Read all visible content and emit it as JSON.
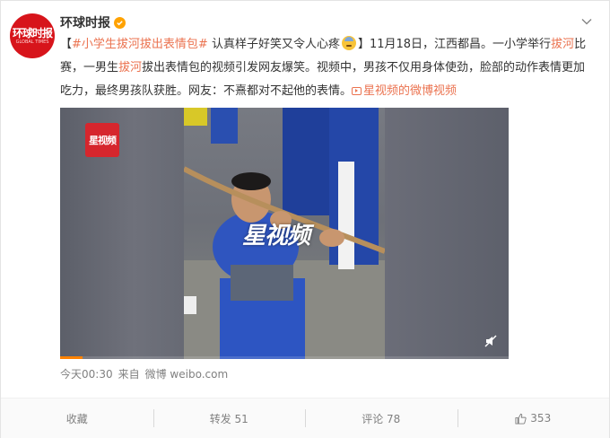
{
  "post": {
    "author": "环球时报",
    "avatar_text": "环球时报",
    "avatar_subtext": "GLOBAL TIMES",
    "text_parts": {
      "bracket_open": "【",
      "topic": "#小学生拔河拔出表情包#",
      "after_topic": " 认真样子好笑又令人心疼",
      "bracket_close": "】11月18日，江西都昌。一小学举行",
      "hl1": "拔河",
      "p1": "比赛，一男生",
      "hl2": "拔河",
      "p2": "拔出表情包的视频引发网友爆笑。视频中，男孩不仅用身体使劲，脸部的动作表情更加吃力，最终男孩队获胜。网友：不熹都对不起他的表情。",
      "video_link": "星视频的微博视频"
    },
    "video": {
      "corner_logo": "星视频",
      "watermark": "星视频",
      "progress": 0.05
    },
    "meta": {
      "time": "今天00:30",
      "source_prefix": "来自",
      "source": "微博 weibo.com"
    },
    "actions": {
      "favorite": "收藏",
      "repost": "转发 51",
      "comment": "评论 78",
      "like": "353"
    }
  },
  "colors": {
    "link": "#eb7350",
    "progress": "#ff8200",
    "avatar_bg": "#d7141b",
    "verified": "#ffa200"
  }
}
